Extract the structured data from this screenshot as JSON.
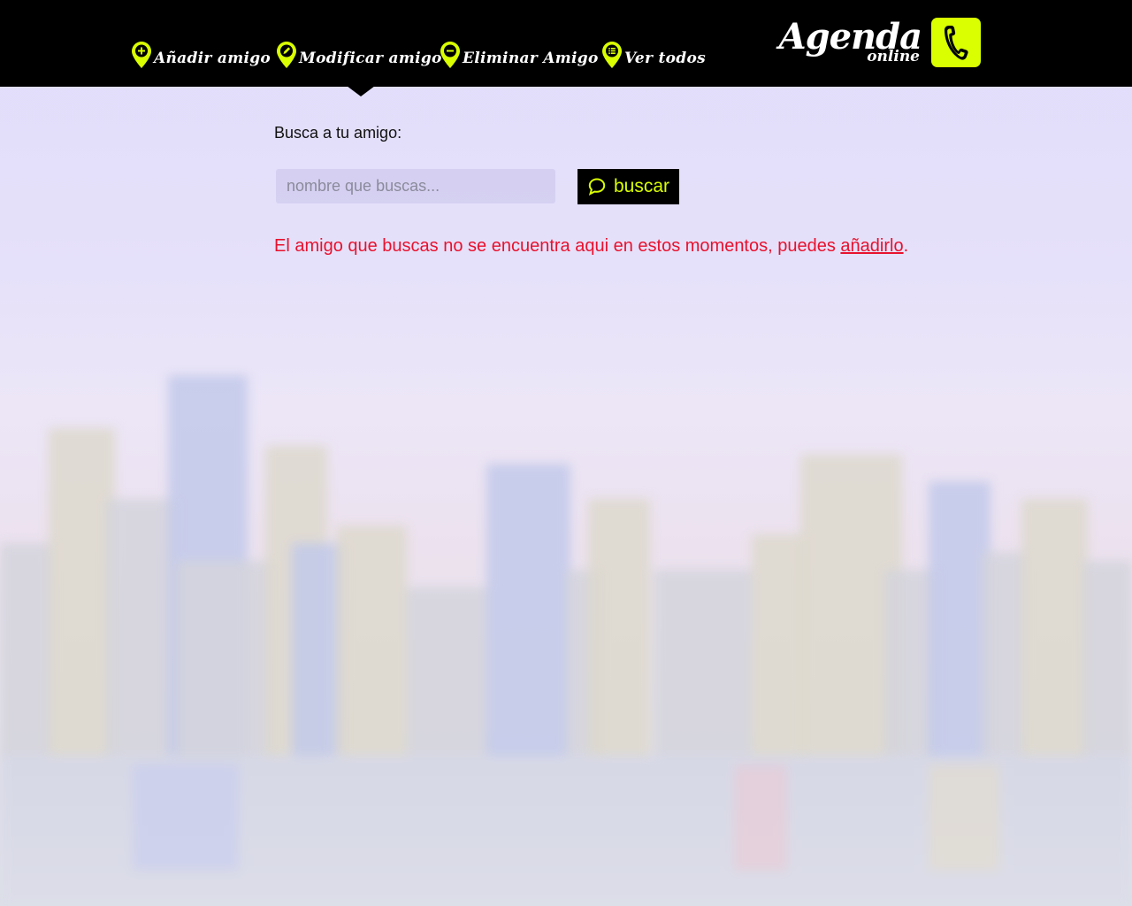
{
  "nav": {
    "items": [
      {
        "label": "Añadir amigo",
        "icon": "add-pin-icon"
      },
      {
        "label": "Modificar amigo",
        "icon": "edit-pin-icon"
      },
      {
        "label": "Eliminar Amigo",
        "icon": "remove-pin-icon"
      },
      {
        "label": "Ver todos",
        "icon": "list-pin-icon"
      }
    ],
    "active_index": 1
  },
  "logo": {
    "title": "Agenda",
    "subtitle": "online",
    "icon": "phone-icon"
  },
  "search": {
    "label": "Busca a tu amigo:",
    "placeholder": "nombre que buscas...",
    "value": "",
    "button_label": "buscar",
    "button_icon": "speech-bubble-icon"
  },
  "result": {
    "message": "El amigo que buscas no se encuentra aqui en estos momentos, puedes ",
    "link_text": "añadirlo",
    "suffix": "."
  },
  "colors": {
    "accent": "#d9ff00",
    "header_bg": "#000000",
    "error": "#e8112d"
  }
}
